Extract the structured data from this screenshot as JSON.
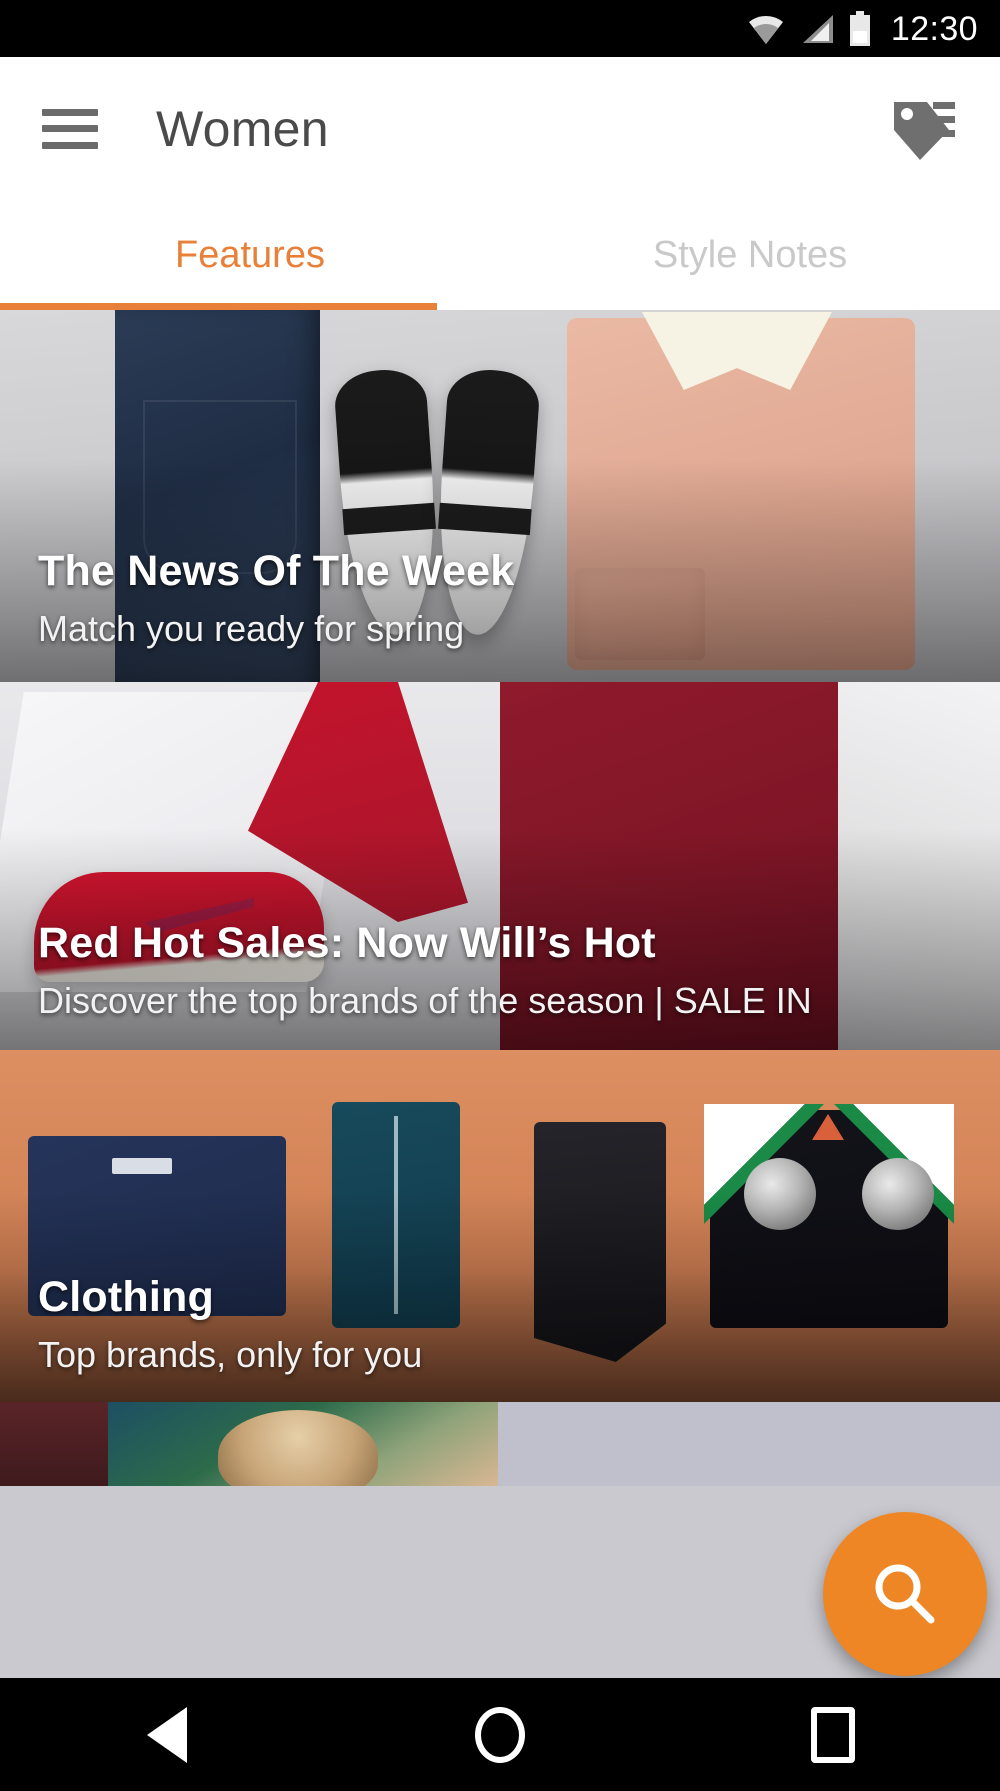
{
  "status_bar": {
    "time": "12:30",
    "icons": [
      "wifi-icon",
      "cellular-signal-icon",
      "battery-icon"
    ]
  },
  "app_bar": {
    "menu_icon": "hamburger-menu-icon",
    "title": "Women",
    "action_icon": "tag-icon"
  },
  "tabs": [
    {
      "label": "Features",
      "active": true
    },
    {
      "label": "Style Notes",
      "active": false
    }
  ],
  "accent_color": "#E8803A",
  "fab": {
    "icon": "search-icon",
    "color": "#EE8626"
  },
  "feed": {
    "cards": [
      {
        "title": "The News Of The Week",
        "subtitle": "Match you ready for spring"
      },
      {
        "title": "Red Hot Sales: Now Will’s Hot",
        "subtitle": "Discover the top brands of the season | SALE IN"
      },
      {
        "title": "Clothing",
        "subtitle": "Top brands, only for you"
      }
    ]
  },
  "nav_bar": {
    "back": "back-triangle-icon",
    "home": "home-circle-icon",
    "recents": "recents-square-icon"
  }
}
